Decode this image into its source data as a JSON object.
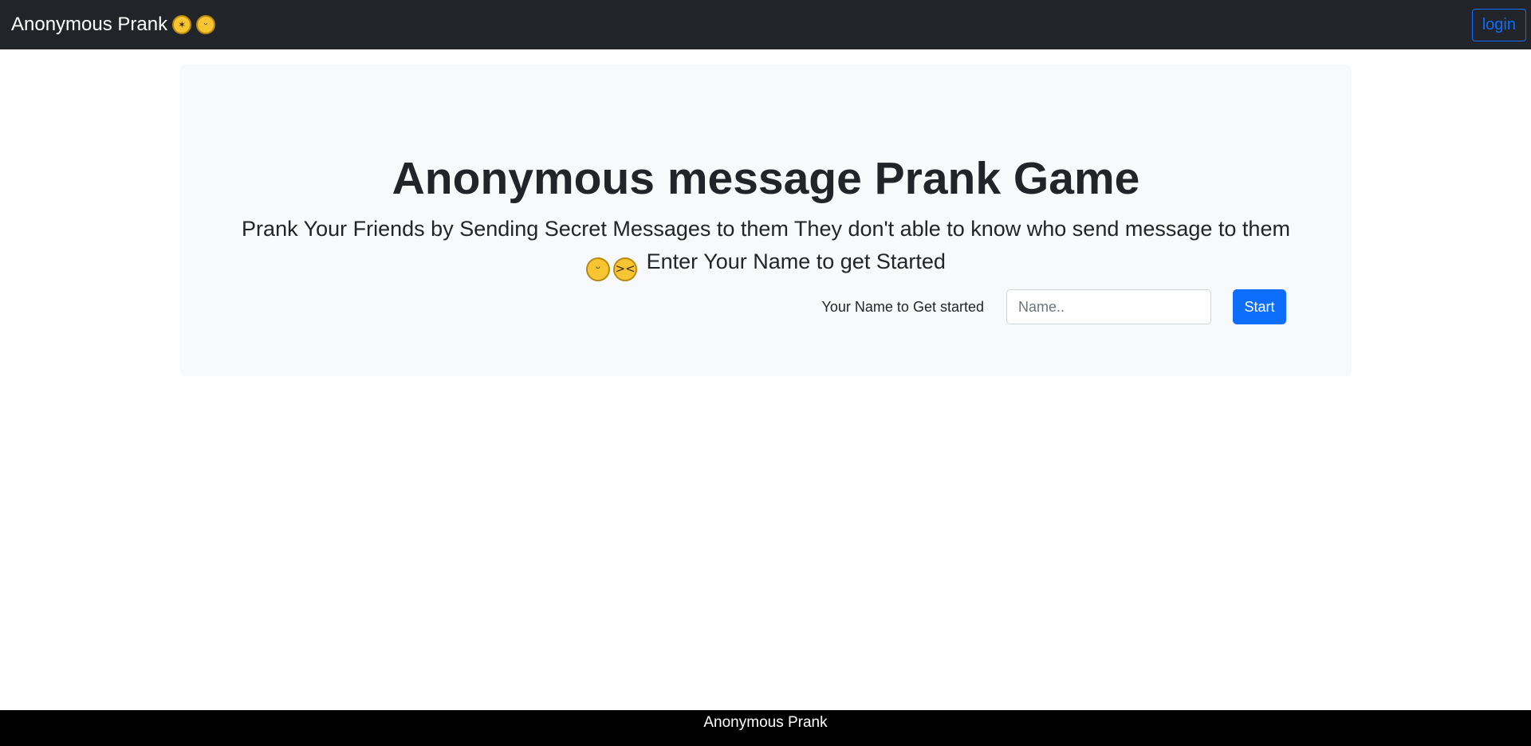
{
  "navbar": {
    "brand": "Anonymous Prank",
    "brand_emojis": [
      "rolling-on-floor-laughing-emoji",
      "grinning-squinting-emoji"
    ],
    "login_label": "login"
  },
  "hero": {
    "title": "Anonymous message Prank Game",
    "subtitle_line1": "Prank Your Friends by Sending Secret Messages to them They don't able to know who send message to them",
    "subtitle_line2": "Enter Your Name to get Started",
    "subtitle_emojis": [
      "face-with-tears-of-joy-emoji",
      "grinning-squinting-face-emoji"
    ],
    "form": {
      "label": "Your Name to Get started",
      "placeholder": "Name..",
      "value": "",
      "button_label": "Start"
    }
  },
  "footer": {
    "text": "Anonymous Prank"
  },
  "colors": {
    "navbar_bg": "#212529",
    "accent": "#0d6efd",
    "hero_bg": "#f8f9fa",
    "footer_bg": "#000000"
  }
}
